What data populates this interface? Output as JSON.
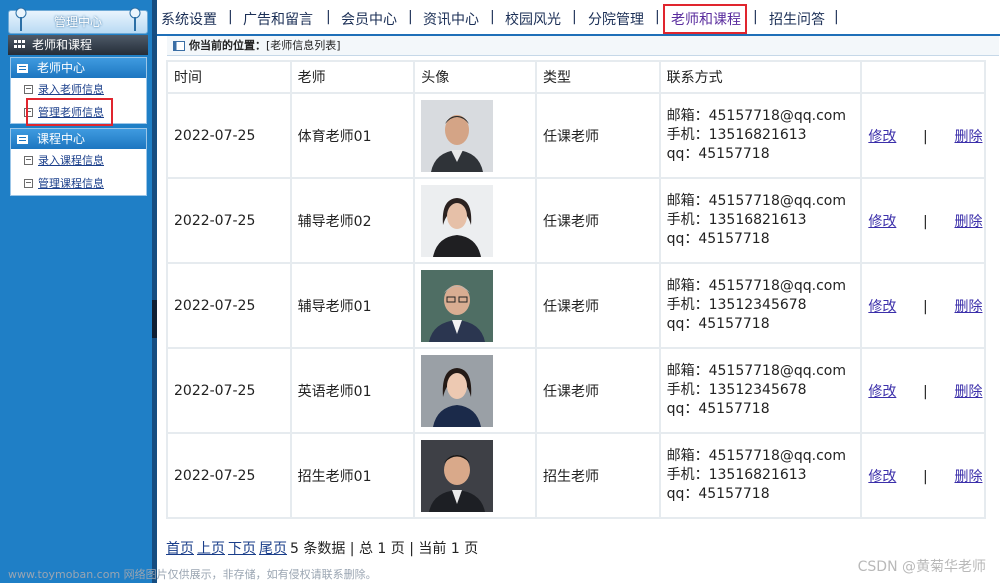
{
  "sidebar": {
    "top_title": "管理中心",
    "section_title": "老师和课程",
    "panels": [
      {
        "title": "老师中心",
        "links": [
          "录入老师信息",
          "管理老师信息"
        ]
      },
      {
        "title": "课程中心",
        "links": [
          "录入课程信息",
          "管理课程信息"
        ]
      }
    ]
  },
  "nav": {
    "items": [
      "系统设置",
      "广告和留言",
      "会员中心",
      "资讯中心",
      "校园风光",
      "分院管理",
      "老师和课程",
      "招生问答"
    ],
    "separator": "|",
    "active_index": 6
  },
  "breadcrumb": {
    "label": "你当前的位置：",
    "path": "[老师信息列表]"
  },
  "table": {
    "headers": [
      "时间",
      "老师",
      "头像",
      "类型",
      "联系方式",
      ""
    ],
    "rows": [
      {
        "date": "2022-07-25",
        "teacher": "体育老师01",
        "type": "任课老师",
        "email": "邮箱：45157718@qq.com",
        "phone": "手机：13516821613",
        "qq": "qq：45157718",
        "avatar": "male-older-avatar"
      },
      {
        "date": "2022-07-25",
        "teacher": "辅导老师02",
        "type": "任课老师",
        "email": "邮箱：45157718@qq.com",
        "phone": "手机：13516821613",
        "qq": "qq：45157718",
        "avatar": "female-avatar"
      },
      {
        "date": "2022-07-25",
        "teacher": "辅导老师01",
        "type": "任课老师",
        "email": "邮箱：45157718@qq.com",
        "phone": "手机：13512345678",
        "qq": "qq：45157718",
        "avatar": "male-glasses-avatar"
      },
      {
        "date": "2022-07-25",
        "teacher": "英语老师01",
        "type": "任课老师",
        "email": "邮箱：45157718@qq.com",
        "phone": "手机：13512345678",
        "qq": "qq：45157718",
        "avatar": "female-avatar-2"
      },
      {
        "date": "2022-07-25",
        "teacher": "招生老师01",
        "type": "招生老师",
        "email": "邮箱：45157718@qq.com",
        "phone": "手机：13516821613",
        "qq": "qq：45157718",
        "avatar": "male-smiling-avatar"
      }
    ],
    "edit_label": "修改",
    "delete_label": "删除",
    "action_separator": "|"
  },
  "pager": {
    "first": "首页",
    "prev": "上页",
    "next": "下页",
    "last": "尾页",
    "summary": "5 条数据 | 总 1 页 | 当前 1 页"
  },
  "watermarks": {
    "right": "CSDN @黄菊华老师",
    "left": "www.toymoban.com 网络图片仅供展示，非存储，如有侵权请联系删除。"
  },
  "colors": {
    "highlight": "#e0252e",
    "sidebar_bg": "#1f7fc6",
    "link": "#1a3e8a"
  }
}
